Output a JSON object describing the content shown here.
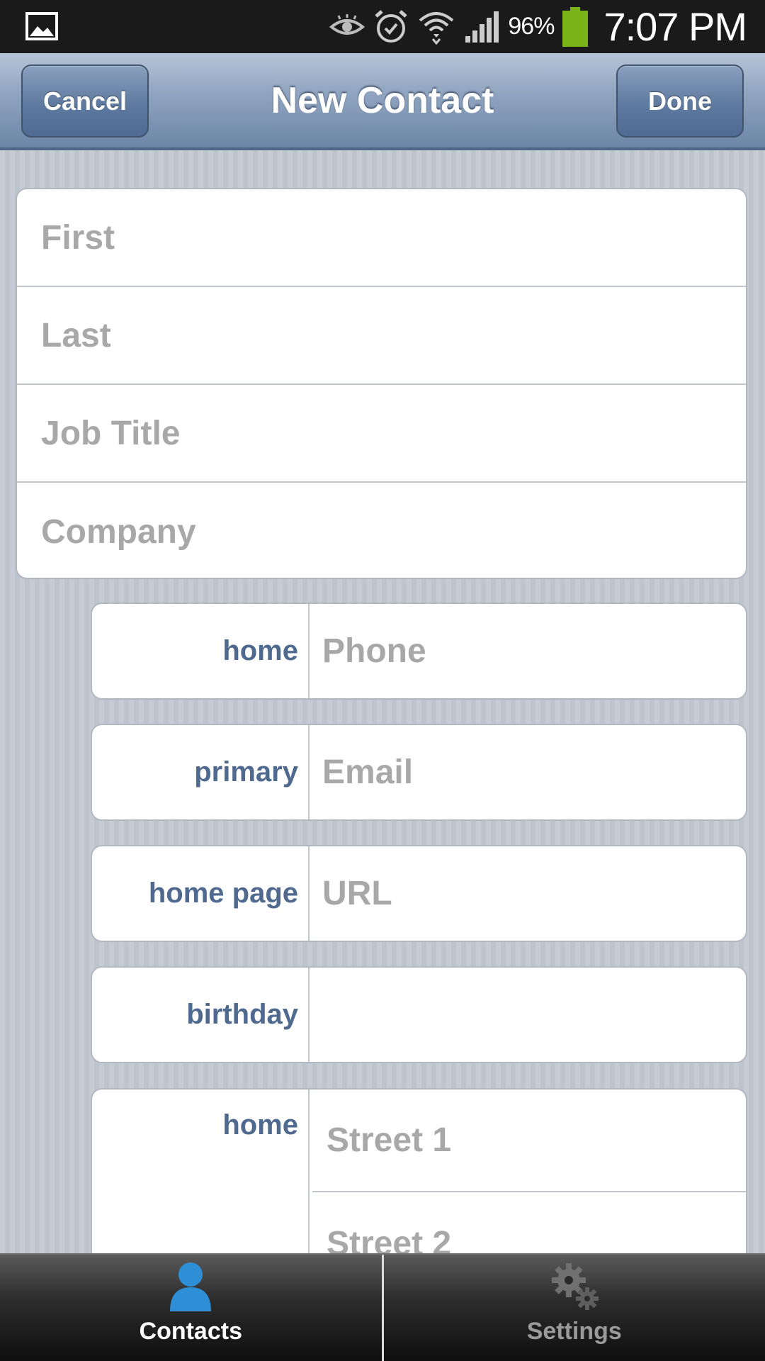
{
  "status_bar": {
    "battery_percent": "96%",
    "time": "7:07 PM",
    "icons": [
      "gallery-icon",
      "eye-icon",
      "alarm-icon",
      "wifi-icon",
      "signal-icon",
      "battery-icon"
    ],
    "battery_color": "#7ab317"
  },
  "nav": {
    "cancel_label": "Cancel",
    "title": "New Contact",
    "done_label": "Done"
  },
  "name_fields": {
    "first_placeholder": "First",
    "last_placeholder": "Last",
    "job_title_placeholder": "Job Title",
    "company_placeholder": "Company"
  },
  "detail_rows": {
    "phone": {
      "label": "home",
      "placeholder": "Phone"
    },
    "email": {
      "label": "primary",
      "placeholder": "Email"
    },
    "url": {
      "label": "home page",
      "placeholder": "URL"
    },
    "birthday": {
      "label": "birthday",
      "value": ""
    }
  },
  "address": {
    "label": "home",
    "street1_placeholder": "Street 1",
    "street2_placeholder": "Street 2"
  },
  "tabs": {
    "contacts_label": "Contacts",
    "settings_label": "Settings",
    "active": "Contacts"
  },
  "colors": {
    "accent_label": "#50698f",
    "nav_bar": "#7f96b5",
    "contacts_icon": "#2f8fd6"
  }
}
